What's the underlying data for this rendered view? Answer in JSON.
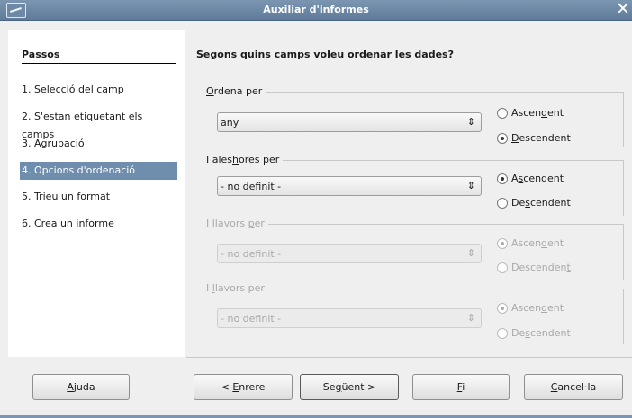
{
  "window": {
    "title": "Auxiliar d'informes",
    "close_glyph": "✕"
  },
  "steps": {
    "heading": "Passos",
    "items": [
      "1. Selecció del camp",
      "2. S'estan etiquetant els camps",
      "3. Agrupació",
      "4. Opcions d'ordenació",
      "5. Trieu un format",
      "6. Crea un informe"
    ],
    "active_index": 3
  },
  "main": {
    "heading": "Segons quins camps voleu ordenar les dades?",
    "groups": [
      {
        "label_pre": "",
        "label_key": "O",
        "label_post": "rdena per",
        "value": "any",
        "enabled": true,
        "asc": {
          "pre": "Ascen",
          "key": "d",
          "post": "ent"
        },
        "desc": {
          "pre": "",
          "key": "D",
          "post": "escendent"
        },
        "selected": "desc"
      },
      {
        "label_pre": "I ales",
        "label_key": "h",
        "label_post": "ores per",
        "value": "- no definit -",
        "enabled": true,
        "asc": {
          "pre": "A",
          "key": "s",
          "post": "cendent"
        },
        "desc": {
          "pre": "De",
          "key": "s",
          "post": "cendent"
        },
        "selected": "asc"
      },
      {
        "label_pre": "I llavors ",
        "label_key": "p",
        "label_post": "er",
        "value": "- no definit -",
        "enabled": false,
        "asc": {
          "pre": "Ascen",
          "key": "d",
          "post": "ent"
        },
        "desc": {
          "pre": "Descenden",
          "key": "t",
          "post": ""
        },
        "selected": "asc"
      },
      {
        "label_pre": "I ",
        "label_key": "l",
        "label_post": "lavors per",
        "value": "- no definit -",
        "enabled": false,
        "asc": {
          "pre": "Ascen",
          "key": "d",
          "post": "ent"
        },
        "desc": {
          "pre": "De",
          "key": "s",
          "post": "cendent"
        },
        "selected": "asc"
      }
    ]
  },
  "buttons": {
    "help": {
      "pre": "",
      "key": "A",
      "post": "juda"
    },
    "back": {
      "pre": "< ",
      "key": "E",
      "post": "nrere"
    },
    "next": {
      "pre": "Se",
      "key": "g",
      "post": "üent >"
    },
    "finish": {
      "pre": "",
      "key": "F",
      "post": "i"
    },
    "cancel": {
      "pre": "",
      "key": "C",
      "post": "ancel·la"
    }
  }
}
